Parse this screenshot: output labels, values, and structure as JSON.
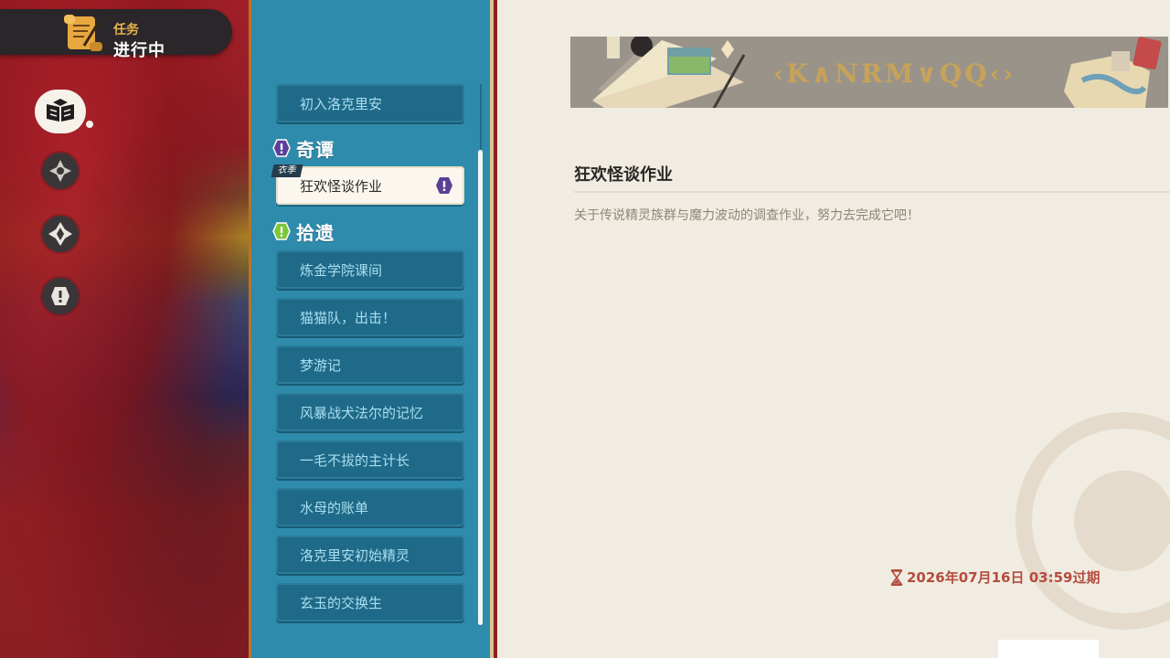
{
  "status_banner": {
    "label_small": "任务",
    "label_big": "进行中"
  },
  "side_icons": [
    "book-icon",
    "compass-icon",
    "target-icon",
    "alert-icon"
  ],
  "quest_list": {
    "top_item": "初入洛克里安",
    "sections": [
      {
        "title": "奇谭",
        "icon": "purple-alert-icon",
        "items": [
          {
            "label": "狂欢怪谈作业",
            "tag": "衣季",
            "selected": true
          }
        ]
      },
      {
        "title": "拾遗",
        "icon": "green-alert-icon",
        "items": [
          {
            "label": "炼金学院课间"
          },
          {
            "label": "猫猫队，出击！"
          },
          {
            "label": "梦游记"
          },
          {
            "label": "风暴战犬法尔的记忆"
          },
          {
            "label": "一毛不拔的主计长"
          },
          {
            "label": "水母的账单"
          },
          {
            "label": "洛克里安初始精灵"
          },
          {
            "label": "玄玉的交换生"
          }
        ]
      }
    ]
  },
  "detail": {
    "title": "狂欢怪谈作业",
    "description": "关于传说精灵族群与魔力波动的调查作业，努力去完成它吧！",
    "expire": "2026年07月16日 03:59过期"
  },
  "colors": {
    "list_bg": "#2e8bab",
    "item_bg": "#1f6a88",
    "detail_bg": "#f1ece1",
    "expire": "#b44c3f",
    "accent_gold": "#e8b34c"
  }
}
